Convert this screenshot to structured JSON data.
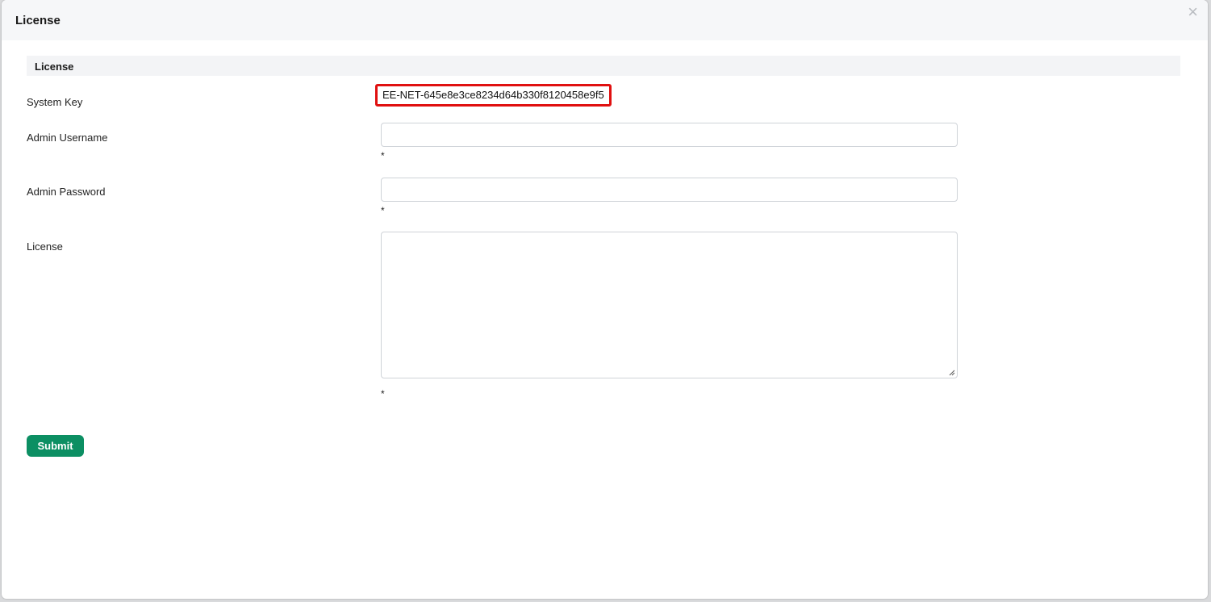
{
  "modal": {
    "title": "License",
    "close_glyph": "×"
  },
  "section": {
    "title": "License"
  },
  "fields": {
    "system_key": {
      "label": "System Key",
      "value": "EE-NET-645e8e3ce8234d64b330f8120458e9f5",
      "highlight_color": "#e01010"
    },
    "admin_username": {
      "label": "Admin Username",
      "value": "",
      "required_mark": "*"
    },
    "admin_password": {
      "label": "Admin Password",
      "value": "",
      "required_mark": "*"
    },
    "license": {
      "label": "License",
      "value": "",
      "required_mark": "*"
    }
  },
  "actions": {
    "submit_label": "Submit",
    "submit_color": "#0c8f63"
  }
}
